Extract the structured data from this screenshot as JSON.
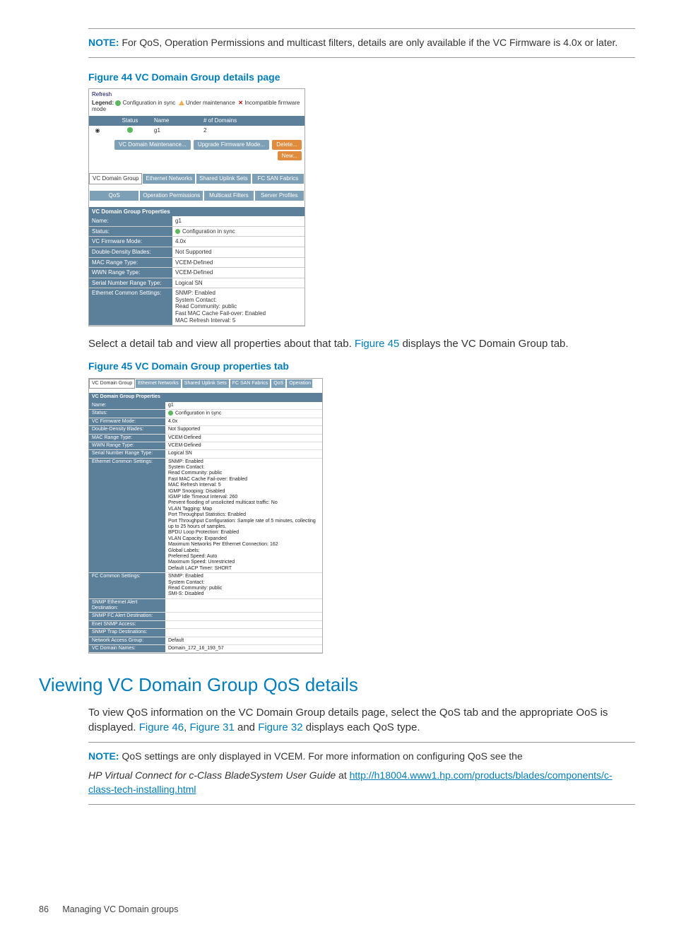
{
  "notes": {
    "note1_label": "NOTE:",
    "note1_text": "For QoS, Operation Permissions and multicast filters, details are only available if the VC Firmware is 4.0x or later.",
    "note2_label": "NOTE:",
    "note2_text_a": "QoS settings are only displayed in VCEM. For more information on configuring QoS see the",
    "note2_italic": "HP Virtual Connect for c-Class BladeSystem User Guide",
    "note2_at": " at ",
    "note2_link": "http://h18004.www1.hp.com/products/blades/components/c-class-tech-installing.html"
  },
  "figures": {
    "fig44_title": "Figure 44 VC Domain Group details page",
    "fig45_title": "Figure 45 VC Domain Group properties tab"
  },
  "para1_a": "Select a detail tab and view all properties about that tab. ",
  "para1_link": "Figure 45",
  "para1_b": " displays the VC Domain Group tab.",
  "heading2": "Viewing VC Domain Group QoS details",
  "para2_a": "To view QoS information on the VC Domain Group details page, select the QoS tab and the appropriate OoS is displayed. ",
  "para2_l1": "Figure 46",
  "para2_s1": ", ",
  "para2_l2": "Figure 31",
  "para2_s2": " and ",
  "para2_l3": "Figure 32",
  "para2_b": " displays each QoS type.",
  "footer": {
    "page": "86",
    "text": "Managing VC Domain groups"
  },
  "fig44": {
    "refresh": "Refresh",
    "legend_label": "Legend:",
    "legend_ok": "Configuration in sync",
    "legend_warn": "Under maintenance",
    "legend_err": "Incompatible firmware mode",
    "cols": {
      "status": "Status",
      "name": "Name",
      "domains": "# of Domains"
    },
    "row": {
      "name": "g1",
      "domains": "2"
    },
    "buttons": {
      "maint": "VC Domain Maintenance...",
      "upgrade": "Upgrade Firmware Mode...",
      "delete": "Delete...",
      "new": "New..."
    },
    "tabs": [
      "VC Domain Group",
      "Ethernet Networks",
      "Shared Uplink Sets",
      "FC SAN Fabrics",
      "QoS",
      "Operation Permissions",
      "Multicast Filters",
      "Server Profiles"
    ],
    "props_header": "VC Domain Group Properties",
    "props": {
      "Name:": "g1",
      "Status:": "Configuration in sync",
      "VC Firmware Mode:": "4.0x",
      "Double-Density Blades:": "Not Supported",
      "MAC Range Type:": "VCEM-Defined",
      "WWN Range Type:": "VCEM-Defined",
      "Serial Number Range Type:": "Logical SN"
    },
    "eth_label": "Ethernet Common Settings:",
    "eth_lines": [
      "SNMP: Enabled",
      "System Contact:",
      "Read Community: public",
      "Fast MAC Cache Fail-over: Enabled",
      "MAC Refresh Interval: 5"
    ]
  },
  "fig45": {
    "tabs": [
      "VC Domain Group",
      "Ethernet Networks",
      "Shared Uplink Sets",
      "FC SAN Fabrics",
      "QoS",
      "Operation"
    ],
    "props_header": "VC Domain Group Properties",
    "rows": {
      "Name:": "g1",
      "Status:": "Configuration in sync",
      "VC Firmware Mode:": "4.0x",
      "Double-Density Blades:": "Not Supported",
      "MAC Range Type:": "VCEM-Defined",
      "WWN Range Type:": "VCEM-Defined",
      "Serial Number Range Type:": "Logical SN"
    },
    "eth_label": "Ethernet Common Settings:",
    "eth_lines": [
      "SNMP: Enabled",
      "System Contact:",
      "Read Community: public",
      "Fast MAC Cache Fail-over: Enabled",
      "MAC Refresh Interval: 5",
      "IGMP Snooping: Disabled",
      "IGMP Idle Timeout Interval: 260",
      "Prevent flooding of unsolicited multicast traffic: No",
      "VLAN Tagging: Map",
      "Port Throughput Statistics: Enabled",
      "Port Throughput Configuration: Sample rate of 5 minutes, collecting up to 25 hours of samples.",
      "BPDU Loop Protection: Enabled",
      "VLAN Capacity: Expanded",
      "Maximum Networks Per Ethernet Connection: 162",
      "Global Labels:",
      "Preferred Speed: Auto",
      "Maximum Speed: Unrestricted",
      "Default LACP Timer: SHORT"
    ],
    "fc_label": "FC Common Settings:",
    "fc_lines": [
      "SNMP: Enabled",
      "System Contact:",
      "Read Community: public",
      "SMI-S: Disabled"
    ],
    "extra": {
      "SNMP Ethernet Alert Destination:": "",
      "SNMP FC Alert Destination:": "",
      "Enet SNMP Access:": "",
      "SNMP Trap Destinations:": "",
      "Network Access Group:": "Default",
      "VC Domain Names:": "Domain_172_16_193_57"
    }
  }
}
